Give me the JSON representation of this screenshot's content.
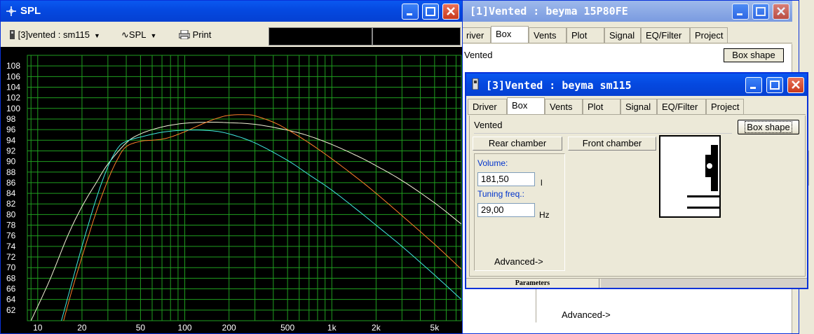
{
  "spl_window": {
    "title": "SPL",
    "toolbar": {
      "driver_select": "[3]vented : sm115",
      "curve_select": "SPL",
      "print_label": "Print"
    }
  },
  "back_window": {
    "title": "[1]Vented : beyma  15P80FE",
    "tabs": [
      "river",
      "Box",
      "Vents",
      "Plot",
      "Signal",
      "EQ/Filter",
      "Project"
    ],
    "box_type": "Vented",
    "box_shape_label": "Box shape",
    "advanced_label": "Advanced->"
  },
  "front_window": {
    "title": "[3]Vented : beyma  sm115",
    "tabs": [
      "Driver",
      "Box",
      "Vents",
      "Plot",
      "Signal",
      "EQ/Filter",
      "Project"
    ],
    "box_type": "Vented",
    "box_shape_label": "Box shape",
    "rear_chamber_label": "Rear chamber",
    "front_chamber_label": "Front chamber",
    "volume_label": "Volume:",
    "volume_value": "181,50",
    "volume_unit": "l",
    "tuning_label": "Tuning freq.:",
    "tuning_value": "29,00",
    "tuning_unit": "Hz",
    "advanced_label": "Advanced->",
    "status_label": "Parameters"
  },
  "chart_data": {
    "type": "line",
    "title": "",
    "xlabel": "",
    "ylabel": "",
    "x_scale": "log",
    "xlim": [
      8.5,
      7600
    ],
    "ylim": [
      60,
      110
    ],
    "grid": true,
    "x_tick_labels": [
      {
        "v": 10,
        "t": "10"
      },
      {
        "v": 20,
        "t": "20"
      },
      {
        "v": 50,
        "t": "50"
      },
      {
        "v": 100,
        "t": "100"
      },
      {
        "v": 200,
        "t": "200"
      },
      {
        "v": 500,
        "t": "500"
      },
      {
        "v": 1000,
        "t": "1k"
      },
      {
        "v": 2000,
        "t": "2k"
      },
      {
        "v": 5000,
        "t": "5k"
      }
    ],
    "y_ticks": [
      62,
      64,
      66,
      68,
      70,
      72,
      74,
      76,
      78,
      80,
      82,
      84,
      86,
      88,
      90,
      92,
      94,
      96,
      98,
      100,
      102,
      104,
      106,
      108
    ],
    "background": "#000000",
    "grid_color": "#1f9e1f",
    "series": [
      {
        "color": "#f4f4d8",
        "x": [
          9,
          12,
          16,
          20,
          25,
          30,
          40,
          50,
          70,
          100,
          150,
          200,
          300,
          500,
          700,
          1000,
          1500,
          2000,
          3000,
          5000,
          7600
        ],
        "y": [
          60,
          67.5,
          76,
          81.5,
          86,
          89.5,
          93.5,
          95.2,
          96.5,
          97.2,
          97.4,
          97.3,
          97,
          95.9,
          94.8,
          93.2,
          91,
          89.2,
          86.4,
          82.2,
          78.2
        ]
      },
      {
        "color": "#ff7f2a",
        "x": [
          15,
          17,
          20,
          25,
          30,
          35,
          40,
          50,
          60,
          70,
          80,
          100,
          130,
          160,
          200,
          260,
          300,
          400,
          500,
          700,
          1000,
          1500,
          2000,
          3000,
          5000,
          7600
        ],
        "y": [
          60,
          65.5,
          72,
          80.5,
          86.5,
          90.5,
          92.8,
          93.8,
          94,
          94.2,
          94.6,
          95.6,
          97,
          98,
          98.7,
          98.8,
          98.6,
          97.4,
          96,
          93.5,
          90.5,
          86.8,
          84,
          79.8,
          74.4,
          69.7
        ]
      },
      {
        "color": "#40e8e0",
        "x": [
          14.5,
          17,
          20,
          25,
          30,
          35,
          40,
          50,
          70,
          100,
          150,
          200,
          300,
          500,
          700,
          1000,
          1500,
          2000,
          3000,
          5000,
          7600
        ],
        "y": [
          60,
          67,
          74,
          83,
          89,
          92.5,
          93.8,
          94.6,
          95.5,
          95.9,
          95.8,
          95.2,
          93.5,
          90.2,
          87.5,
          84.6,
          80.8,
          78,
          74,
          68.6,
          64
        ]
      }
    ]
  }
}
